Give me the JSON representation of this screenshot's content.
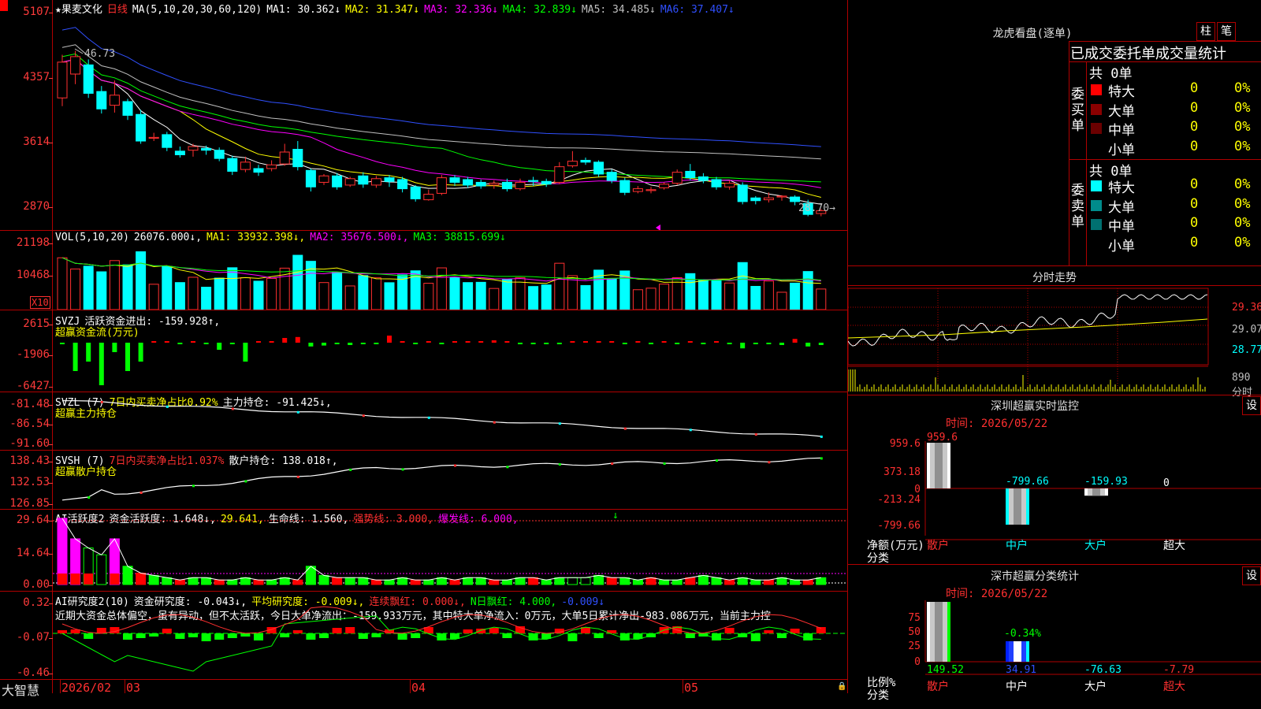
{
  "main_chart": {
    "star_marker": "★",
    "stock_name": "果麦文化",
    "period": "日线",
    "ma_params": "MA(5,10,20,30,60,120)",
    "ma_items": [
      {
        "label": "MA1: 30.362↓",
        "color": "#ffffff"
      },
      {
        "label": "MA2: 31.347↓",
        "color": "#ffff00"
      },
      {
        "label": "MA3: 32.336↓",
        "color": "#ff00ff"
      },
      {
        "label": "MA4: 32.839↓",
        "color": "#00ff00"
      },
      {
        "label": "MA5: 34.485↓",
        "color": "#c0c0c0"
      },
      {
        "label": "MA6: 37.407↓",
        "color": "#3050ff"
      }
    ],
    "y_ticks": [
      "5107",
      "4357",
      "3614",
      "2870"
    ],
    "high_label": "46.73",
    "low_label": "28.70→"
  },
  "volume_panel": {
    "title": "VOL(5,10,20)",
    "items": [
      {
        "label": "26076.000↓,",
        "color": "#ffffff"
      },
      {
        "label": "MA1: 33932.398↓,",
        "color": "#ffff00"
      },
      {
        "label": "MA2: 35676.500↓,",
        "color": "#ff00ff"
      },
      {
        "label": "MA3: 38815.699↓",
        "color": "#00ff00"
      }
    ],
    "y_ticks": [
      "21198",
      "10468"
    ],
    "unit_badge": "X10"
  },
  "svzj_panel": {
    "title": "SVZJ",
    "items": [
      {
        "label": "活跃资金进出: -159.928↑,",
        "color": "#ffffff"
      }
    ],
    "subtitle": "超赢资金流(万元)",
    "y_ticks": [
      "2615",
      "-1906",
      "-6427"
    ]
  },
  "svzl_panel": {
    "title": "SVZL (7)",
    "items": [
      {
        "label": "7日内买卖净占比0.92%",
        "color": "#ffff00"
      },
      {
        "label": "主力持仓: -91.425↓,",
        "color": "#ffffff"
      }
    ],
    "subtitle": "超赢主力持仓",
    "y_ticks": [
      "-81.48",
      "-86.54",
      "-91.60"
    ]
  },
  "svsh_panel": {
    "title": "SVSH (7)",
    "items": [
      {
        "label": "7日内买卖净占比1.037%",
        "color": "#ff3030"
      },
      {
        "label": "散户持仓: 138.018↑,",
        "color": "#ffffff"
      }
    ],
    "subtitle": "超赢散户持仓",
    "y_ticks": [
      "138.43",
      "132.53",
      "126.85"
    ]
  },
  "ai_active_panel": {
    "title": "AI活跃度2",
    "items": [
      {
        "label": "资金活跃度: 1.648↓,",
        "color": "#ffffff"
      },
      {
        "label": "29.641,",
        "color": "#ffff00"
      },
      {
        "label": "生命线: 1.560,",
        "color": "#ffffff"
      },
      {
        "label": "强势线: 3.000,",
        "color": "#ff3030"
      },
      {
        "label": "爆发线: 6.000,",
        "color": "#ff00ff"
      }
    ],
    "y_ticks": [
      "29.64",
      "14.64",
      "0.00"
    ]
  },
  "ai_research_panel": {
    "title": "AI研究度2(10)",
    "items": [
      {
        "label": "资金研究度: -0.043↓,",
        "color": "#ffffff"
      },
      {
        "label": "平均研究度: -0.009↓,",
        "color": "#ffff00"
      },
      {
        "label": "连续飘红: 0.000↓,",
        "color": "#ff3030"
      },
      {
        "label": "N日飘红: 4.000,",
        "color": "#00ff00"
      },
      {
        "label": "-0.009↓",
        "color": "#3050ff"
      }
    ],
    "commentary": "近期大资金总体偏空，虽有异动，但不太活跃，今日大单净流出：-159.933万元，其中特大单净流入：0万元，大单5日累计净出-983.086万元，当前主力控",
    "y_ticks": [
      "0.32",
      "-0.07",
      "-0.46"
    ]
  },
  "x_axis": {
    "brand": "大智慧",
    "labels": [
      "2026/02",
      "03",
      "04",
      "05"
    ]
  },
  "dragon_tiger": {
    "title": "龙虎看盘(逐单)",
    "buttons": [
      "柱",
      "笔"
    ],
    "header": "已成交委托单成交量统计",
    "buy": {
      "side_label": "委买单",
      "total": "共 0单",
      "rows": [
        {
          "name": "特大",
          "value": "0",
          "pct": "0%",
          "color": "#ff0000"
        },
        {
          "name": "大单",
          "value": "0",
          "pct": "0%",
          "color": "#8b0000"
        },
        {
          "name": "中单",
          "value": "0",
          "pct": "0%",
          "color": "#6b0000"
        },
        {
          "name": "小单",
          "value": "0",
          "pct": "0%",
          "color": "#000000"
        }
      ]
    },
    "sell": {
      "side_label": "委卖单",
      "total": "共 0单",
      "rows": [
        {
          "name": "特大",
          "value": "0",
          "pct": "0%",
          "color": "#00ffff"
        },
        {
          "name": "大单",
          "value": "0",
          "pct": "0%",
          "color": "#008b8b"
        },
        {
          "name": "中单",
          "value": "0",
          "pct": "0%",
          "color": "#007070"
        },
        {
          "name": "小单",
          "value": "0",
          "pct": "0%",
          "color": "#000000"
        }
      ]
    }
  },
  "intraday": {
    "title": "分时走势",
    "price_ticks": [
      "29.36",
      "29.07",
      "28.77"
    ],
    "vol_tick": "890",
    "vol_label": "分时"
  },
  "realtime_monitor": {
    "title": "深圳超赢实时监控",
    "settings_btn": "设",
    "time_label": "时间: 2026/05/22",
    "y_ticks": [
      "959.6",
      "373.18",
      "0",
      "-213.24",
      "-799.66"
    ],
    "y_unit_1": "净额(万元)",
    "y_unit_2": "分类",
    "categories": [
      "散户",
      "中户",
      "大户",
      "超大"
    ],
    "values": [
      "959.6",
      "-799.66",
      "-159.93",
      "0"
    ],
    "cat_colors": [
      "#ff3030",
      "#00ffff",
      "#00ffff",
      "#ffffff"
    ]
  },
  "classification": {
    "title": "深市超赢分类统计",
    "settings_btn": "设",
    "time_label": "时间: 2026/05/22",
    "y_ticks": [
      "75",
      "50",
      "25",
      "0"
    ],
    "y_unit_1": "比例%",
    "y_unit_2": "分类",
    "mid_label": "-0.34%",
    "categories": [
      "散户",
      "中户",
      "大户",
      "超大"
    ],
    "values": [
      "149.52",
      "34.91",
      "-76.63",
      "-7.79"
    ],
    "value_colors": [
      "#00ff00",
      "#3050ff",
      "#00ffff",
      "#ff3030"
    ]
  },
  "chart_data": [
    {
      "type": "line",
      "title": "果麦文化 日线",
      "y_range": [
        28.7,
        51.07
      ],
      "series": [
        {
          "name": "MA1",
          "last": 30.362
        },
        {
          "name": "MA2",
          "last": 31.347
        },
        {
          "name": "MA3",
          "last": 32.336
        },
        {
          "name": "MA4",
          "last": 32.839
        },
        {
          "name": "MA5",
          "last": 34.485
        },
        {
          "name": "MA6",
          "last": 37.407
        }
      ],
      "high": 46.73,
      "low": 28.7,
      "candles": [
        [
          41.6,
          45.5,
          40.7,
          46.3
        ],
        [
          44.2,
          46.1,
          43.1,
          46.73
        ],
        [
          45.2,
          42.1,
          41.6,
          45.8
        ],
        [
          42.3,
          40.4,
          39.9,
          42.9
        ],
        [
          40.8,
          41.9,
          40.0,
          43.5
        ],
        [
          41.2,
          39.7,
          39.2,
          41.5
        ],
        [
          39.8,
          36.9,
          36.6,
          40.3
        ],
        [
          37.2,
          37.3,
          36.9,
          37.8
        ],
        [
          37.6,
          36.2,
          35.8,
          37.9
        ],
        [
          35.8,
          35.4,
          35.1,
          36.3
        ],
        [
          35.9,
          36.3,
          35.2,
          36.6
        ],
        [
          36.1,
          35.9,
          35.4,
          36.4
        ],
        [
          35.9,
          35.0,
          34.7,
          36.2
        ],
        [
          35.0,
          33.6,
          33.2,
          35.3
        ],
        [
          33.8,
          34.6,
          33.5,
          35.2
        ],
        [
          33.9,
          33.5,
          33.1,
          34.3
        ],
        [
          33.9,
          34.3,
          33.6,
          34.8
        ],
        [
          34.4,
          35.7,
          34.2,
          36.6
        ],
        [
          36.0,
          34.1,
          33.7,
          36.9
        ],
        [
          33.7,
          31.9,
          31.4,
          33.9
        ],
        [
          32.4,
          33.1,
          32.1,
          33.3
        ],
        [
          33.1,
          31.9,
          31.6,
          33.4
        ],
        [
          32.1,
          32.8,
          31.9,
          33.0
        ],
        [
          33.1,
          32.2,
          31.8,
          33.5
        ],
        [
          32.1,
          32.8,
          31.8,
          33.1
        ],
        [
          32.9,
          32.5,
          31.9,
          33.2
        ],
        [
          32.7,
          31.7,
          31.3,
          33.0
        ],
        [
          31.9,
          30.6,
          30.3,
          32.1
        ],
        [
          30.5,
          31.1,
          30.4,
          31.6
        ],
        [
          31.2,
          32.9,
          31.0,
          33.2
        ],
        [
          32.9,
          32.4,
          32.0,
          33.2
        ],
        [
          32.7,
          32.1,
          31.8,
          33.0
        ],
        [
          32.4,
          32.0,
          31.7,
          32.7
        ],
        [
          32.1,
          32.3,
          31.7,
          32.6
        ],
        [
          32.4,
          31.7,
          31.4,
          32.8
        ],
        [
          31.7,
          32.4,
          31.5,
          32.8
        ],
        [
          32.6,
          32.5,
          32.0,
          33.0
        ],
        [
          32.5,
          32.2,
          31.9,
          32.8
        ],
        [
          32.4,
          34.1,
          32.2,
          34.6
        ],
        [
          34.2,
          34.7,
          34.0,
          35.8
        ],
        [
          34.8,
          34.6,
          34.3,
          35.1
        ],
        [
          34.6,
          33.3,
          33.0,
          34.8
        ],
        [
          33.5,
          32.6,
          32.3,
          33.8
        ],
        [
          32.6,
          31.3,
          31.0,
          32.9
        ],
        [
          31.4,
          31.7,
          31.2,
          32.0
        ],
        [
          31.5,
          31.6,
          31.2,
          31.9
        ],
        [
          31.8,
          32.2,
          31.6,
          32.4
        ],
        [
          32.3,
          33.5,
          32.1,
          33.8
        ],
        [
          33.6,
          32.9,
          32.6,
          34.4
        ],
        [
          33.0,
          32.6,
          32.3,
          33.4
        ],
        [
          32.7,
          31.9,
          31.6,
          33.0
        ],
        [
          31.9,
          32.3,
          31.6,
          32.6
        ],
        [
          32.1,
          30.3,
          30.0,
          32.4
        ],
        [
          30.7,
          30.4,
          30.0,
          30.9
        ],
        [
          30.5,
          30.7,
          30.2,
          31.3
        ],
        [
          30.8,
          30.9,
          30.4,
          31.0
        ],
        [
          30.8,
          30.3,
          29.9,
          31.0
        ],
        [
          30.1,
          28.9,
          28.7,
          30.5
        ],
        [
          29.0,
          29.3,
          28.7,
          29.5
        ]
      ]
    }
  ]
}
